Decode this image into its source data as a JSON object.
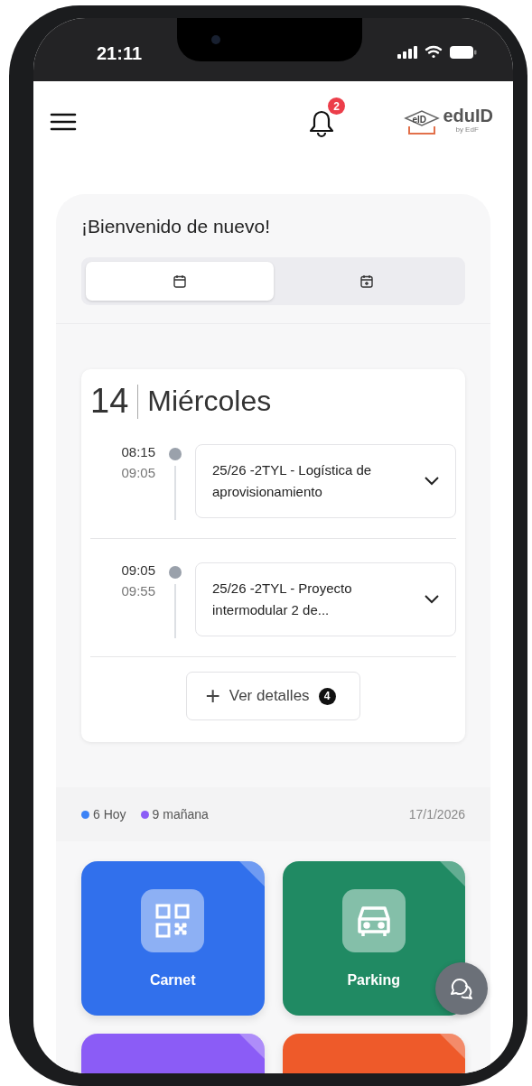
{
  "status_bar": {
    "time": "21:11"
  },
  "header": {
    "notification_count": "2",
    "logo": {
      "mark": "eID",
      "name": "eduID",
      "byline": "by EdF"
    }
  },
  "welcome": {
    "title": "¡Bienvenido de nuevo!"
  },
  "view_tabs": [
    {
      "kind": "calendar",
      "selected": true
    },
    {
      "kind": "calendar-plus",
      "selected": false
    }
  ],
  "day": {
    "number": "14",
    "weekday": "Miércoles"
  },
  "events": [
    {
      "start": "08:15",
      "end": "09:05",
      "title": "25/26 -2TYL - Logística de aprovisionamiento"
    },
    {
      "start": "09:05",
      "end": "09:55",
      "title": "25/26 -2TYL - Proyecto intermodular 2 de..."
    }
  ],
  "details_button": {
    "icon": "+",
    "label": "Ver detalles",
    "count": "4"
  },
  "legend": [
    {
      "label": "6 Hoy",
      "color": "#3b82f6"
    },
    {
      "label": "9 mañana",
      "color": "#8b5cf6"
    }
  ],
  "date": "17/1/2026",
  "tiles": [
    {
      "kind": "qr",
      "label": "Carnet",
      "color": "#3170ec"
    },
    {
      "kind": "car",
      "label": "Parking",
      "color": "#208a63"
    },
    {
      "kind": "blank",
      "color": "#8b5cf6"
    },
    {
      "kind": "blank",
      "color": "#ee5a2a"
    }
  ]
}
